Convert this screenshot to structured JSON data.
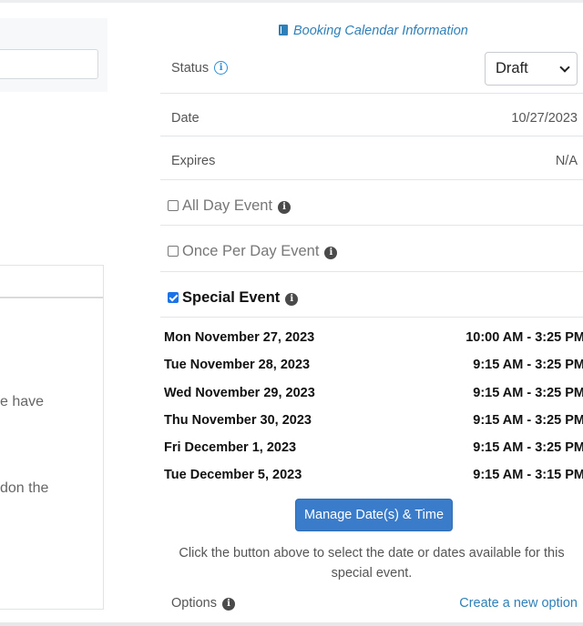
{
  "left": {
    "text_line1": "e have",
    "text_line2": "don the"
  },
  "header": {
    "info_link": "Booking Calendar Information"
  },
  "fields": {
    "status_label": "Status",
    "status_value": "Draft",
    "date_label": "Date",
    "date_value": "10/27/2023",
    "expires_label": "Expires",
    "expires_value": "N/A"
  },
  "options": {
    "all_day": {
      "label": "All Day Event",
      "checked": false
    },
    "once_per_day": {
      "label": "Once Per Day Event",
      "checked": false
    },
    "special": {
      "label": "Special Event",
      "checked": true
    }
  },
  "schedule": [
    {
      "date": "Mon November 27, 2023",
      "time": "10:00 AM - 3:25 PM"
    },
    {
      "date": "Tue November 28, 2023",
      "time": "9:15 AM - 3:25 PM"
    },
    {
      "date": "Wed November 29, 2023",
      "time": "9:15 AM - 3:25 PM"
    },
    {
      "date": "Thu November 30, 2023",
      "time": "9:15 AM - 3:25 PM"
    },
    {
      "date": "Fri December 1, 2023",
      "time": "9:15 AM - 3:25 PM"
    },
    {
      "date": "Tue December 5, 2023",
      "time": "9:15 AM - 3:15 PM"
    }
  ],
  "actions": {
    "manage_button": "Manage Date(s) & Time",
    "help_text": "Click the button above to select the date or dates available for this special event.",
    "options_label": "Options",
    "create_link": "Create a new option"
  },
  "icons": {
    "info_blue": "i",
    "info_dark": "i"
  }
}
